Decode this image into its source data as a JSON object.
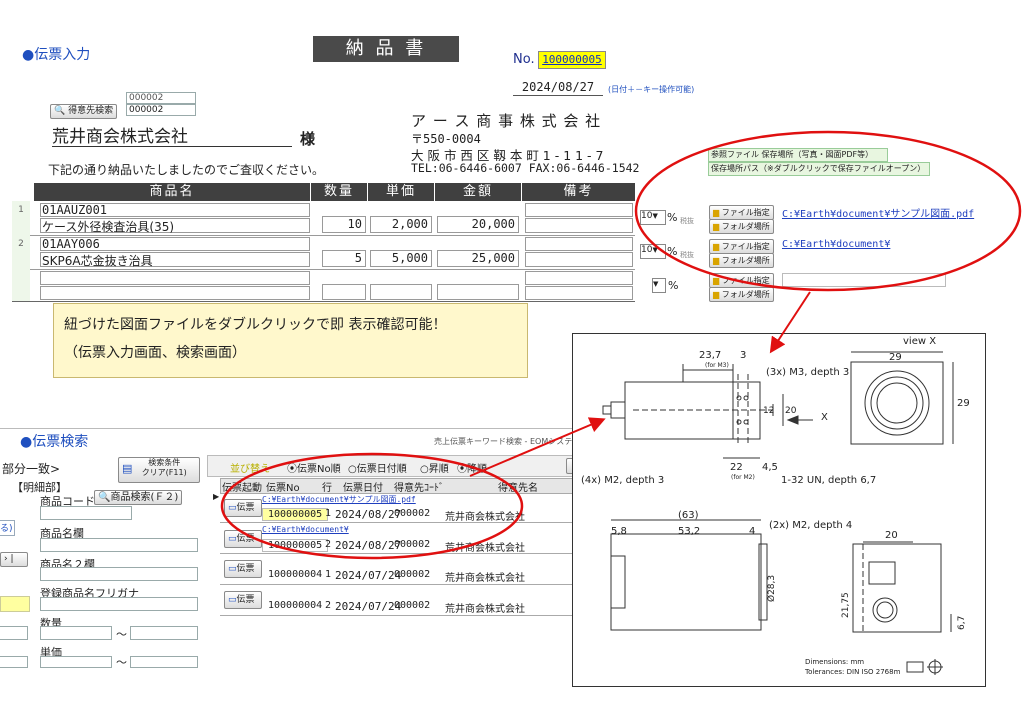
{
  "upper": {
    "section_title": "●伝票入力",
    "doc_title": "納 品 書",
    "no_label": "No.",
    "no_value": "100000005",
    "date": "2024/08/27",
    "date_hint": "(日付＋－キー操作可能)",
    "cust_code_1": "000002",
    "cust_code_2": "000002",
    "cust_search_button": "得意先検索",
    "customer_name": "荒井商会株式会社",
    "honorific": "様",
    "greeting": "下記の通り納品いたしましたのでご査収ください。",
    "company_name": "ア ー ス 商 事 株 式 会 社",
    "postal": "〒550-0004",
    "address": "大 阪 市 西 区 靱 本 町 1 - 1 1 - 7",
    "tel_fax": "TEL:06-6446-6007 FAX:06-6446-1542",
    "headers": [
      "商品名",
      "数量",
      "単価",
      "金額",
      "備考"
    ],
    "rows": [
      {
        "num": "1",
        "code": "01AAUZ001",
        "name": "ケース外径検査治具(35)",
        "qty": "10",
        "price": "2,000",
        "amount": "20,000",
        "tax": "10",
        "tax_label": "税抜",
        "link": "C:¥Earth¥document¥サンプル図面.pdf"
      },
      {
        "num": "2",
        "code": "01AAY006",
        "name": "SKP6A芯金抜き治具",
        "qty": "5",
        "price": "5,000",
        "amount": "25,000",
        "tax": "10",
        "tax_label": "税抜",
        "link": "C:¥Earth¥document¥"
      },
      {
        "num": "",
        "code": "",
        "name": "",
        "qty": "",
        "price": "",
        "amount": "",
        "tax": "",
        "tax_label": "",
        "link": ""
      }
    ],
    "pct": "%",
    "file_button": "ファイル指定",
    "folder_button": "フォルダ場所",
    "ref_file_label": "参照ファイル 保存場所（写真・図面PDF等）",
    "save_path_label": "保存場所パス（※ダブルクリックで保存ファイルオープン）"
  },
  "callout": {
    "line1": "紐づけた図面ファイルをダブルクリックで即 表示確認可能！",
    "line2": "（伝票入力画面、検索画面）"
  },
  "drawing": {
    "view_x": "view X",
    "d_23_7": "23,7",
    "d_3": "3",
    "for_m3": "(for M3)",
    "m3_note": "(3x) M3, depth 3",
    "d_29a": "29",
    "d_29b": "29",
    "d_12": "12",
    "d_20": "20",
    "x_arrow": "X",
    "m2_note_4x": "(4x) M2, depth 3",
    "d_22": "22",
    "d_4_5": "4,5",
    "for_m2": "(for M2)",
    "thread_note": "1-32 UN, depth 6,7",
    "d_63": "(63)",
    "d_5_8": "5,8",
    "d_53_2": "53,2",
    "d_4": "4",
    "m2_note_2x": "(2x) M2, depth 4",
    "d_20b": "20",
    "d_28_3": "Ø28,3",
    "d_21_75": "21,75",
    "d_6_7": "6,7",
    "dims": "Dimensions: mm",
    "tol": "Tolerances: DIN ISO 2768m"
  },
  "lower": {
    "title": "●伝票検索",
    "subtitle": "売上伝票キーワード検索 - EOMシステム",
    "match_label": "部分一致>",
    "clear_button": "検索条件\nクリア(F11)",
    "detail_label": "【明細部】",
    "product_code_label": "商品コード",
    "product_search_button": "商品検索(Ｆ２)",
    "product_name_label": "商品名欄",
    "product_name2_label": "商品名２欄",
    "reg_kana_label": "登録商品名フリガナ",
    "qty_label": "数量",
    "price_label": "単価",
    "tilde": "～",
    "sort_label": "並び替え",
    "sort_options": [
      "伝票No順",
      "伝票日付順",
      "昇順",
      "降順"
    ],
    "grid_headers": [
      "伝票起動",
      "伝票No",
      "行",
      "伝票日付",
      "得意先ｺｰﾄﾞ",
      "得意先名"
    ],
    "open_button": "伝票",
    "grid_rows": [
      {
        "link": "C:¥Earth¥document¥サンプル図面.pdf",
        "no": "100000005",
        "line": "1",
        "date": "2024/08/27",
        "code": "000002",
        "name": "荒井商会株式会社"
      },
      {
        "link": "C:¥Earth¥document¥",
        "no": "100000005",
        "line": "2",
        "date": "2024/08/27",
        "code": "000002",
        "name": "荒井商会株式会社"
      },
      {
        "link": "",
        "no": "100000004",
        "line": "1",
        "date": "2024/07/24",
        "code": "000002",
        "name": "荒井商会株式会社"
      },
      {
        "link": "",
        "no": "100000004",
        "line": "2",
        "date": "2024/07/24",
        "code": "000002",
        "name": "荒井商会株式会社"
      }
    ]
  },
  "colors": {
    "accent": "#1f4fbf",
    "annotation": "#e01010",
    "header_dark": "#404040",
    "callout_bg": "#fff8cc",
    "highlight": "#ffff00"
  }
}
